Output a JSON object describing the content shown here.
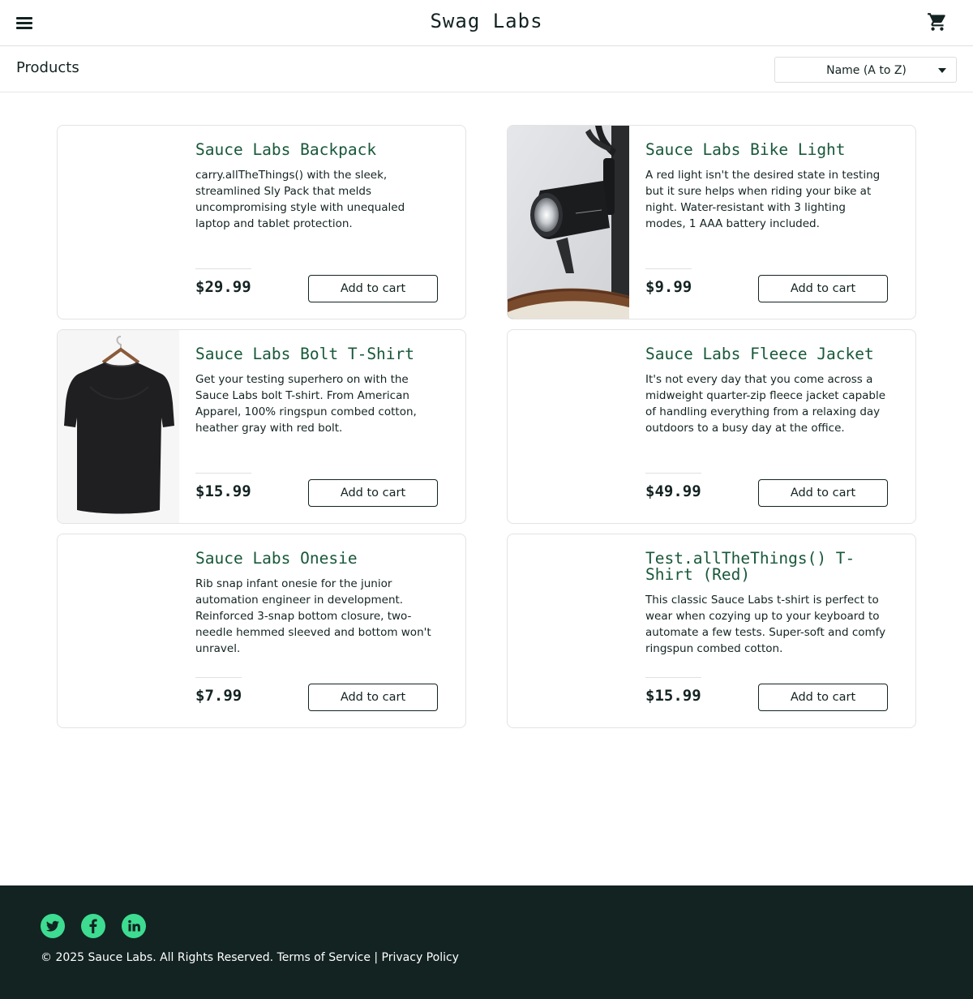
{
  "header": {
    "menu_icon": "hamburger-menu-icon",
    "brand": "Swag Labs",
    "cart_icon": "shopping-cart-icon"
  },
  "subheader": {
    "title": "Products",
    "sort_selected": "Name (A to Z)"
  },
  "products": [
    {
      "name": "Sauce Labs Backpack",
      "description": "carry.allTheThings() with the sleek, streamlined Sly Pack that melds uncompromising style with unequaled laptop and tablet protection.",
      "price": "$29.99",
      "button": "Add to cart",
      "image": "none"
    },
    {
      "name": "Sauce Labs Bike Light",
      "description": "A red light isn't the desired state in testing but it sure helps when riding your bike at night. Water-resistant with 3 lighting modes, 1 AAA battery included.",
      "price": "$9.99",
      "button": "Add to cart",
      "image": "bike-light"
    },
    {
      "name": "Sauce Labs Bolt T-Shirt",
      "description": "Get your testing superhero on with the Sauce Labs bolt T-shirt. From American Apparel, 100% ringspun combed cotton, heather gray with red bolt.",
      "price": "$15.99",
      "button": "Add to cart",
      "image": "black-tshirt"
    },
    {
      "name": "Sauce Labs Fleece Jacket",
      "description": "It's not every day that you come across a midweight quarter-zip fleece jacket capable of handling everything from a relaxing day outdoors to a busy day at the office.",
      "price": "$49.99",
      "button": "Add to cart",
      "image": "none"
    },
    {
      "name": "Sauce Labs Onesie",
      "description": "Rib snap infant onesie for the junior automation engineer in development. Reinforced 3-snap bottom closure, two-needle hemmed sleeved and bottom won't unravel.",
      "price": "$7.99",
      "button": "Add to cart",
      "image": "none"
    },
    {
      "name": "Test.allTheThings() T-Shirt (Red)",
      "description": "This classic Sauce Labs t-shirt is perfect to wear when cozying up to your keyboard to automate a few tests. Super-soft and comfy ringspun combed cotton.",
      "price": "$15.99",
      "button": "Add to cart",
      "image": "none"
    }
  ],
  "footer": {
    "social": [
      "twitter-icon",
      "facebook-icon",
      "linkedin-icon"
    ],
    "copyright": "© 2025 Sauce Labs. All Rights Reserved. Terms of Service | Privacy Policy"
  },
  "colors": {
    "product_name": "#18583a",
    "footer_bg": "#132322",
    "social_accent": "#3ddc91",
    "text": "#132322"
  }
}
